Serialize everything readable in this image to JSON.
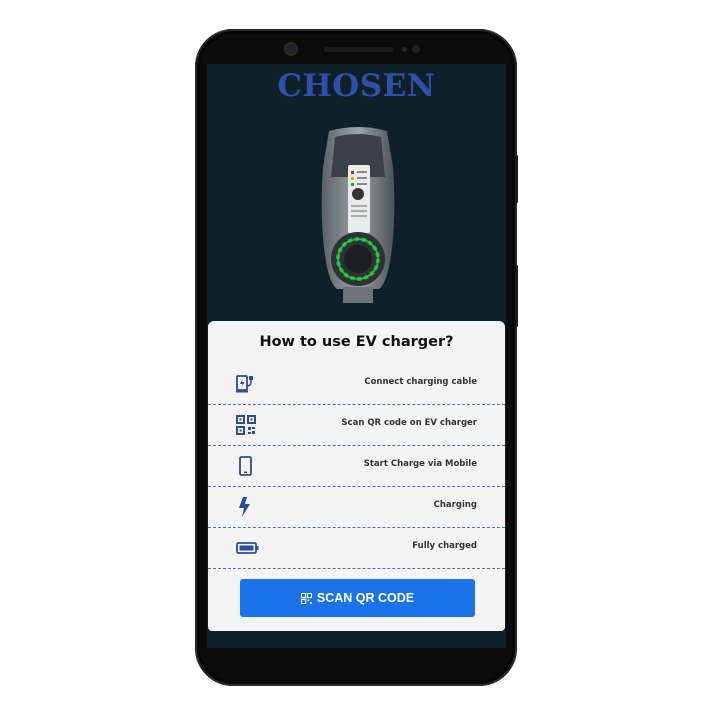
{
  "app": {
    "brand": "CHOSEN"
  },
  "guide": {
    "title": "How to use EV charger?",
    "steps": [
      {
        "icon": "ev-plug-icon",
        "label": "Connect charging cable"
      },
      {
        "icon": "qr-code-icon",
        "label": "Scan QR code on EV charger"
      },
      {
        "icon": "mobile-phone-icon",
        "label": "Start Charge via Mobile"
      },
      {
        "icon": "lightning-bolt-icon",
        "label": "Charging"
      },
      {
        "icon": "battery-full-icon",
        "label": "Fully charged"
      }
    ]
  },
  "actions": {
    "scan_label": "SCAN QR CODE"
  },
  "colors": {
    "brand": "#2f4fa8",
    "screen_bg": "#0e2128",
    "primary_button": "#1a73e8",
    "icon": "#2b4c97",
    "charger_ring": "#33d14a"
  }
}
